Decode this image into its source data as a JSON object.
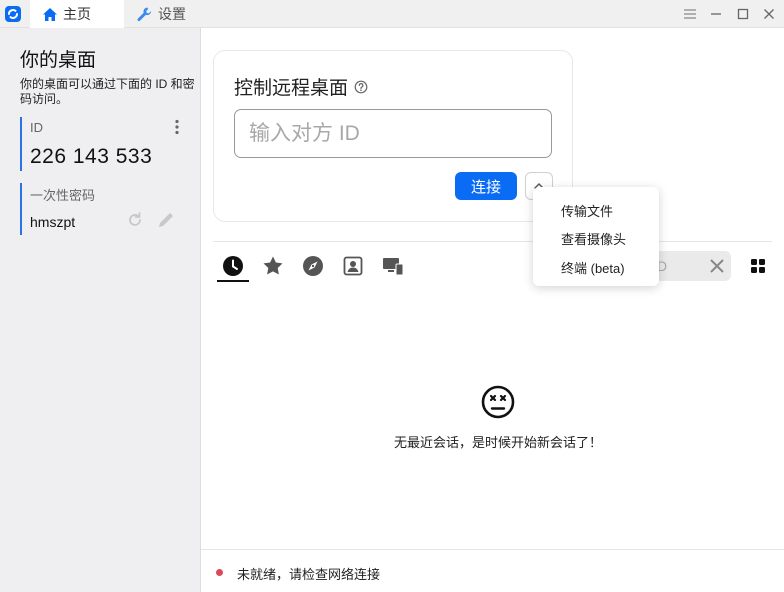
{
  "titlebar": {
    "tabs": [
      {
        "label": "主页",
        "icon": "home-icon",
        "active": true
      },
      {
        "label": "设置",
        "icon": "wrench-icon",
        "active": false
      }
    ],
    "controls": [
      "menu-icon",
      "minimize-icon",
      "maximize-icon",
      "close-icon"
    ]
  },
  "sidebar": {
    "title": "你的桌面",
    "description": "你的桌面可以通过下面的 ID 和密码访问。",
    "id_label": "ID",
    "id_value": "226 143 533",
    "password_label": "一次性密码",
    "password_value": "hmszpt"
  },
  "remote": {
    "title": "控制远程桌面",
    "input_placeholder": "输入对方 ID",
    "input_value": "",
    "connect_label": "连接"
  },
  "popup_menu": {
    "items": [
      "传输文件",
      "查看摄像头",
      "终端 (beta)"
    ]
  },
  "peers": {
    "tabs": [
      "recent-sessions-icon",
      "favorites-icon",
      "discovered-icon",
      "address-book-icon",
      "group-icon"
    ],
    "active_tab": 0,
    "search_placeholder": "D",
    "empty_message": "无最近会话，是时候开始新会话了！"
  },
  "status": {
    "text": "未就绪，请检查网络连接",
    "dot_color": "#d84a5a"
  },
  "colors": {
    "accent": "#0a6cf5",
    "sidebar_border": "#2a72e8"
  }
}
